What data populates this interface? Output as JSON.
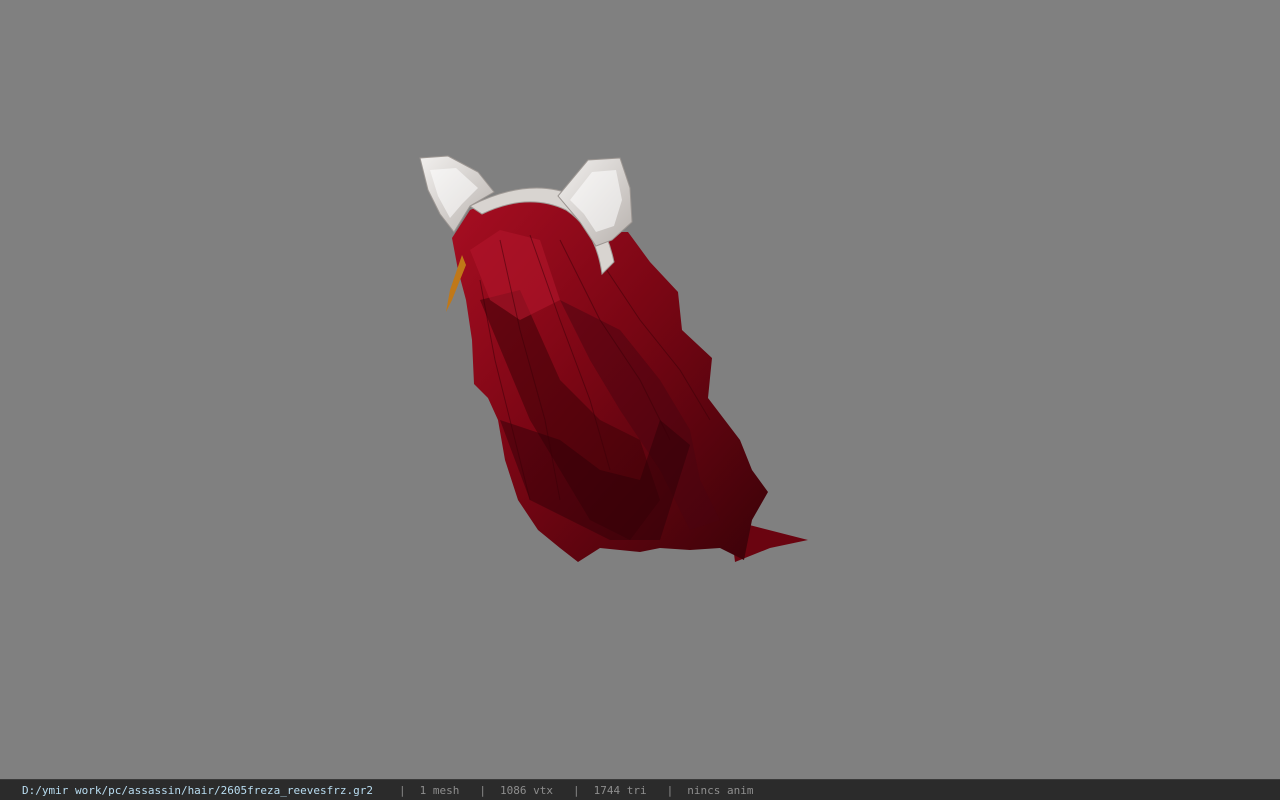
{
  "viewport": {
    "background_color": "#808080",
    "model": {
      "hair_color": "#8b0a1a",
      "ear_color": "#e0dcd8"
    }
  },
  "status_bar": {
    "file_path": "D:/ymir work/pc/assassin/hair/2605freza_reevesfrz.gr2",
    "separator": "|",
    "mesh_count": "1 mesh",
    "vertex_count": "1086 vtx",
    "triangle_count": "1744 tri",
    "anim_status": "nincs anim"
  }
}
